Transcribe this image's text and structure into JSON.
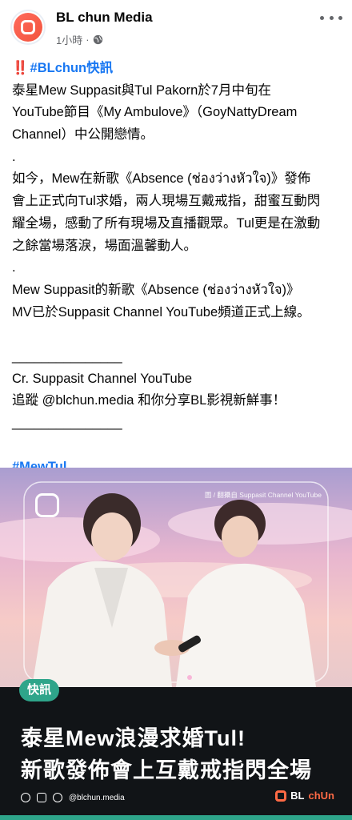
{
  "post": {
    "page_name": "BL chun Media",
    "time_ago": "1小時",
    "separator": "·",
    "privacy_icon": "globe-icon",
    "more_icon": "more-horizontal-icon"
  },
  "body": {
    "alert_mark": "‼️",
    "hashtag_title": "#BLchun快訊",
    "lines": [
      "泰星Mew Suppasit與Tul Pakorn於7月中旬在",
      "YouTube節目《My Ambulove》（GoyNattyDream",
      "Channel）中公開戀情。",
      ".",
      "如今，Mew在新歌《Absence (ช่องว่างหัวใจ)》發佈",
      "會上正式向Tul求婚，兩人現場互戴戒指，甜蜜互動閃",
      "耀全場，感動了所有現場及直播觀眾。Tul更是在激動",
      "之餘當場落淚，場面溫馨動人。",
      ".",
      "Mew Suppasit的新歌《Absence (ช่องว่างหัวใจ)》",
      "MV已於Suppasit Channel YouTube頻道正式上線。",
      "",
      "_______________",
      "Cr. Suppasit Channel YouTube",
      "追蹤 @blchun.media 和你分享BL影視新鮮事！",
      "_______________",
      "",
      ""
    ],
    "hashtag_bottom": "#MewTul"
  },
  "image": {
    "photo_credit": "圖 / 翻攝自 Suppasit Channel YouTube",
    "badge": "快訊",
    "headline_line1": "泰星Mew浪漫求婚Tul!",
    "headline_line2": "新歌發佈會上互戴戒指閃全場",
    "handle": "@blchun.media",
    "brand_prefix": "BL",
    "brand_suffix": "chUn",
    "accent": "#2ea58a",
    "brand_color": "#ff6a45"
  }
}
